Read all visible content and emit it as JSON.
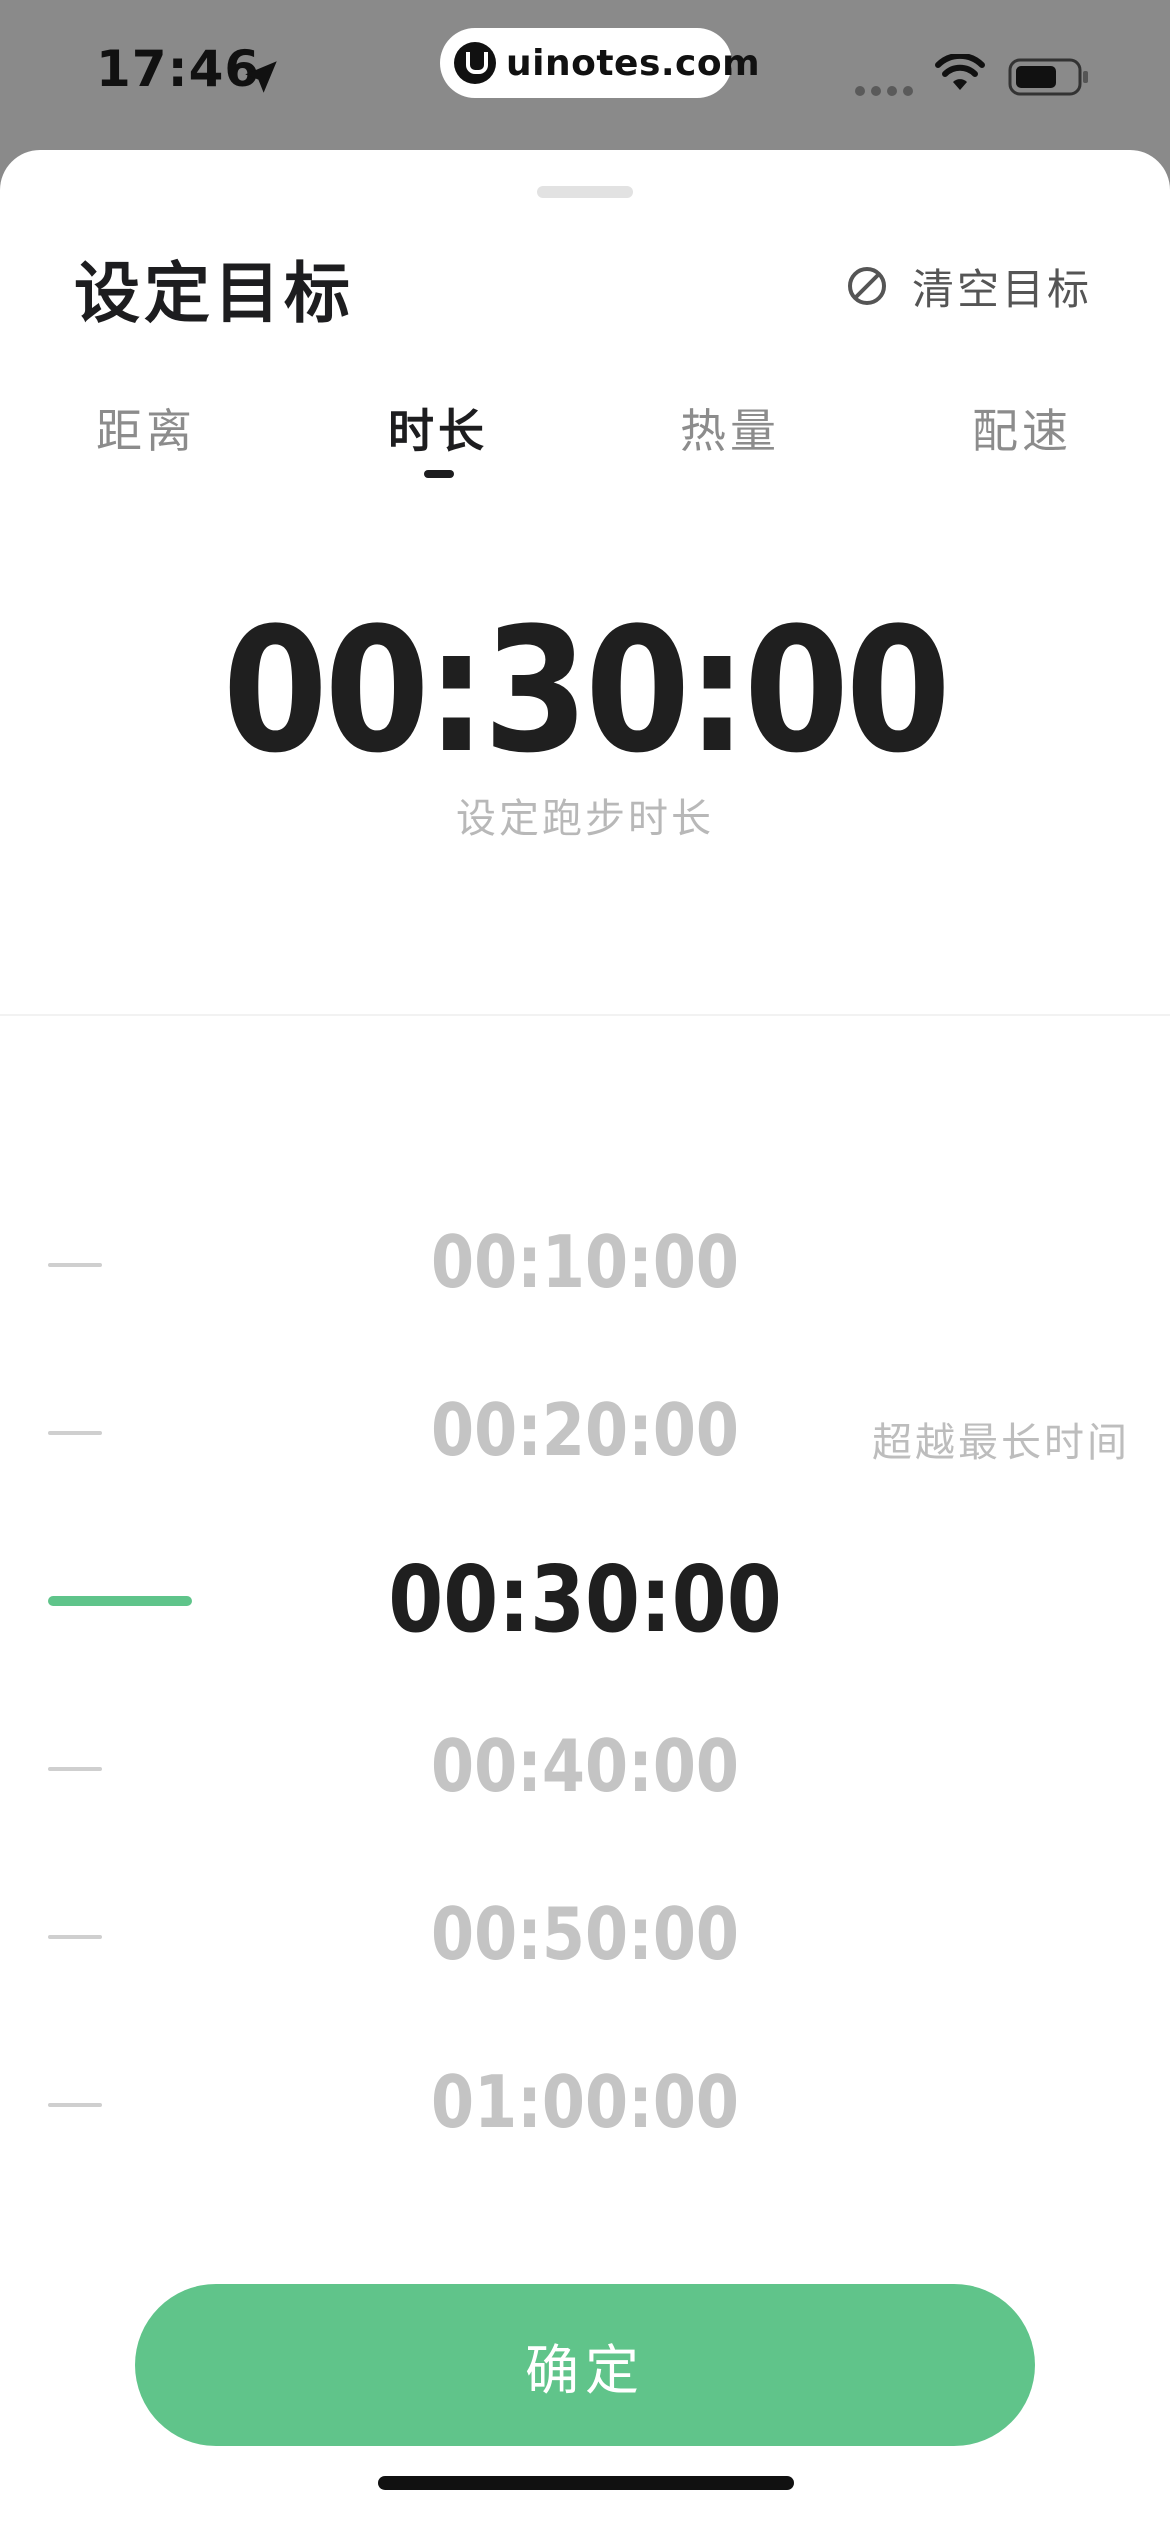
{
  "status_bar": {
    "time": "17:46",
    "site": "uinotes.com"
  },
  "sheet": {
    "title": "设定目标",
    "clear_label": "清空目标",
    "tabs": [
      {
        "label": "距离"
      },
      {
        "label": "时长"
      },
      {
        "label": "热量"
      },
      {
        "label": "配速"
      }
    ],
    "active_tab": "时长",
    "value": "00:30:00",
    "caption": "设定跑步时长"
  },
  "picker": {
    "items": [
      {
        "value": "00:10:00"
      },
      {
        "value": "00:20:00",
        "note": "超越最长时间"
      },
      {
        "value": "00:30:00"
      },
      {
        "value": "00:40:00"
      },
      {
        "value": "00:50:00"
      },
      {
        "value": "01:00:00"
      }
    ],
    "selected": "00:30:00"
  },
  "confirm_label": "确定",
  "colors": {
    "accent": "#60c48a",
    "text_primary": "#1f1f1f",
    "text_muted": "#c4c4c4"
  }
}
